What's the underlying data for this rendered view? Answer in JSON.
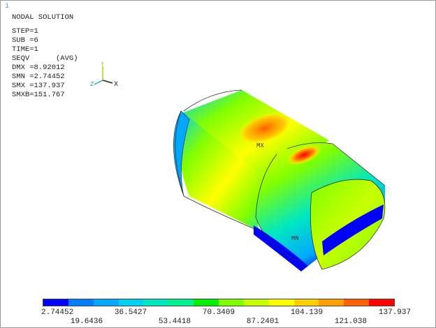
{
  "window_number": "1",
  "header": {
    "title": "NODAL SOLUTION",
    "step": "STEP=1",
    "sub": "SUB =6",
    "time": "TIME=1",
    "result": "SEQV      (AVG)",
    "dmx": "DMX =8.92012",
    "smn": "SMN =2.74452",
    "smx": "SMX =137.937",
    "smxb": "SMXB=151.767"
  },
  "triad": {
    "x_label": "X",
    "y_label": "Y",
    "z_label": "Z"
  },
  "model": {
    "max_label": "MX",
    "min_label": "MN"
  },
  "legend": {
    "colors": [
      "#0000ff",
      "#0080ff",
      "#00a8ff",
      "#00d0f0",
      "#00e8c0",
      "#00f090",
      "#00f000",
      "#80ff00",
      "#c8ff00",
      "#ffff00",
      "#ffd000",
      "#ffa000",
      "#ff6000",
      "#ff0000"
    ],
    "labels_top": [
      "2.74452",
      "36.5427",
      "70.3409",
      "104.139",
      "137.937"
    ],
    "labels_bottom": [
      "19.6436",
      "53.4418",
      "87.2401",
      "121.038"
    ]
  }
}
